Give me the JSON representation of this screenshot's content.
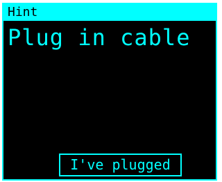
{
  "dialog": {
    "title": "Hint",
    "message": "Plug in cable",
    "button_label": "I've plugged"
  },
  "colors": {
    "accent": "#00ffff",
    "background": "#000000"
  }
}
